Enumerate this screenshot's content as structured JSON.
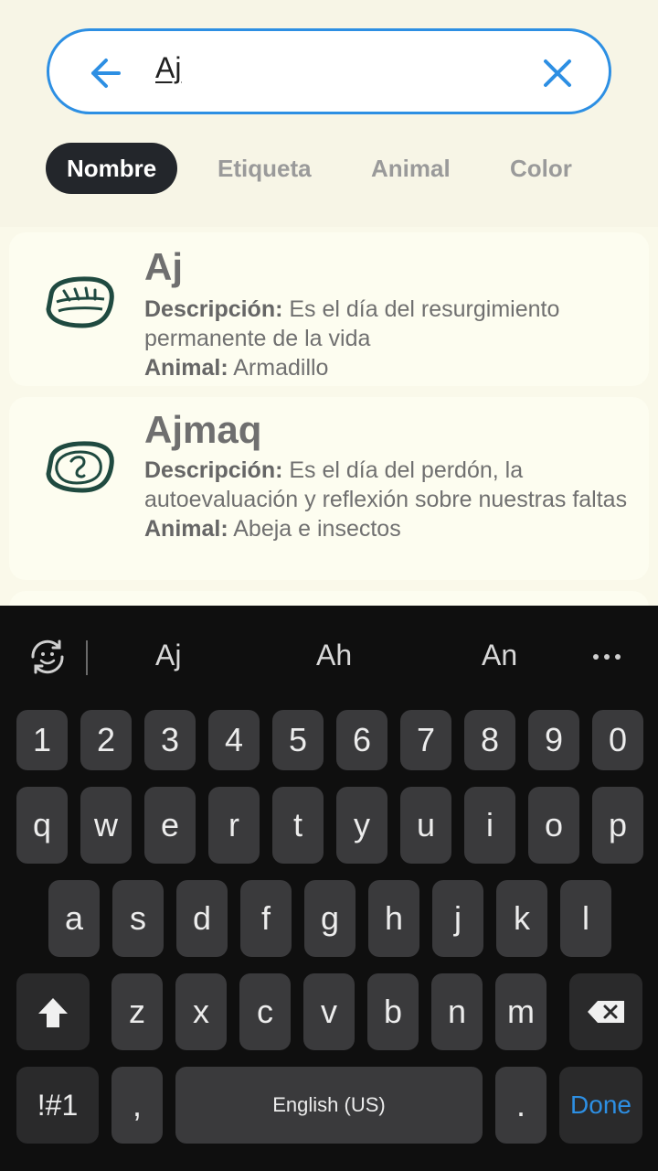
{
  "search": {
    "query": "Aj"
  },
  "filters": [
    {
      "label": "Nombre",
      "active": true
    },
    {
      "label": "Etiqueta",
      "active": false
    },
    {
      "label": "Animal",
      "active": false
    },
    {
      "label": "Color",
      "active": false
    }
  ],
  "results": [
    {
      "title": "Aj",
      "desc_label": "Descripción:",
      "desc_value": " Es el día del resurgimiento permanente de la vida",
      "animal_label": "Animal:",
      "animal_value": " Armadillo",
      "glyph_icon": "aj-glyph-icon"
    },
    {
      "title": "Ajmaq",
      "desc_label": "Descripción:",
      "desc_value": " Es el día del perdón, la autoevaluación y reflexión sobre nuestras faltas",
      "animal_label": "Animal:",
      "animal_value": " Abeja e insectos",
      "glyph_icon": "ajmaq-glyph-icon"
    }
  ],
  "keyboard": {
    "suggestions": [
      "Aj",
      "Ah",
      "An"
    ],
    "row_numbers": [
      "1",
      "2",
      "3",
      "4",
      "5",
      "6",
      "7",
      "8",
      "9",
      "0"
    ],
    "row1": [
      "q",
      "w",
      "e",
      "r",
      "t",
      "y",
      "u",
      "i",
      "o",
      "p"
    ],
    "row2": [
      "a",
      "s",
      "d",
      "f",
      "g",
      "h",
      "j",
      "k",
      "l"
    ],
    "row3": [
      "z",
      "x",
      "c",
      "v",
      "b",
      "n",
      "m"
    ],
    "symbols_label": "!#1",
    "comma": ",",
    "space_label": "English (US)",
    "period": ".",
    "done_label": "Done"
  },
  "colors": {
    "accent": "#2d8fe3",
    "chip_active_bg": "#23262b",
    "glyph": "#1f4a40"
  }
}
